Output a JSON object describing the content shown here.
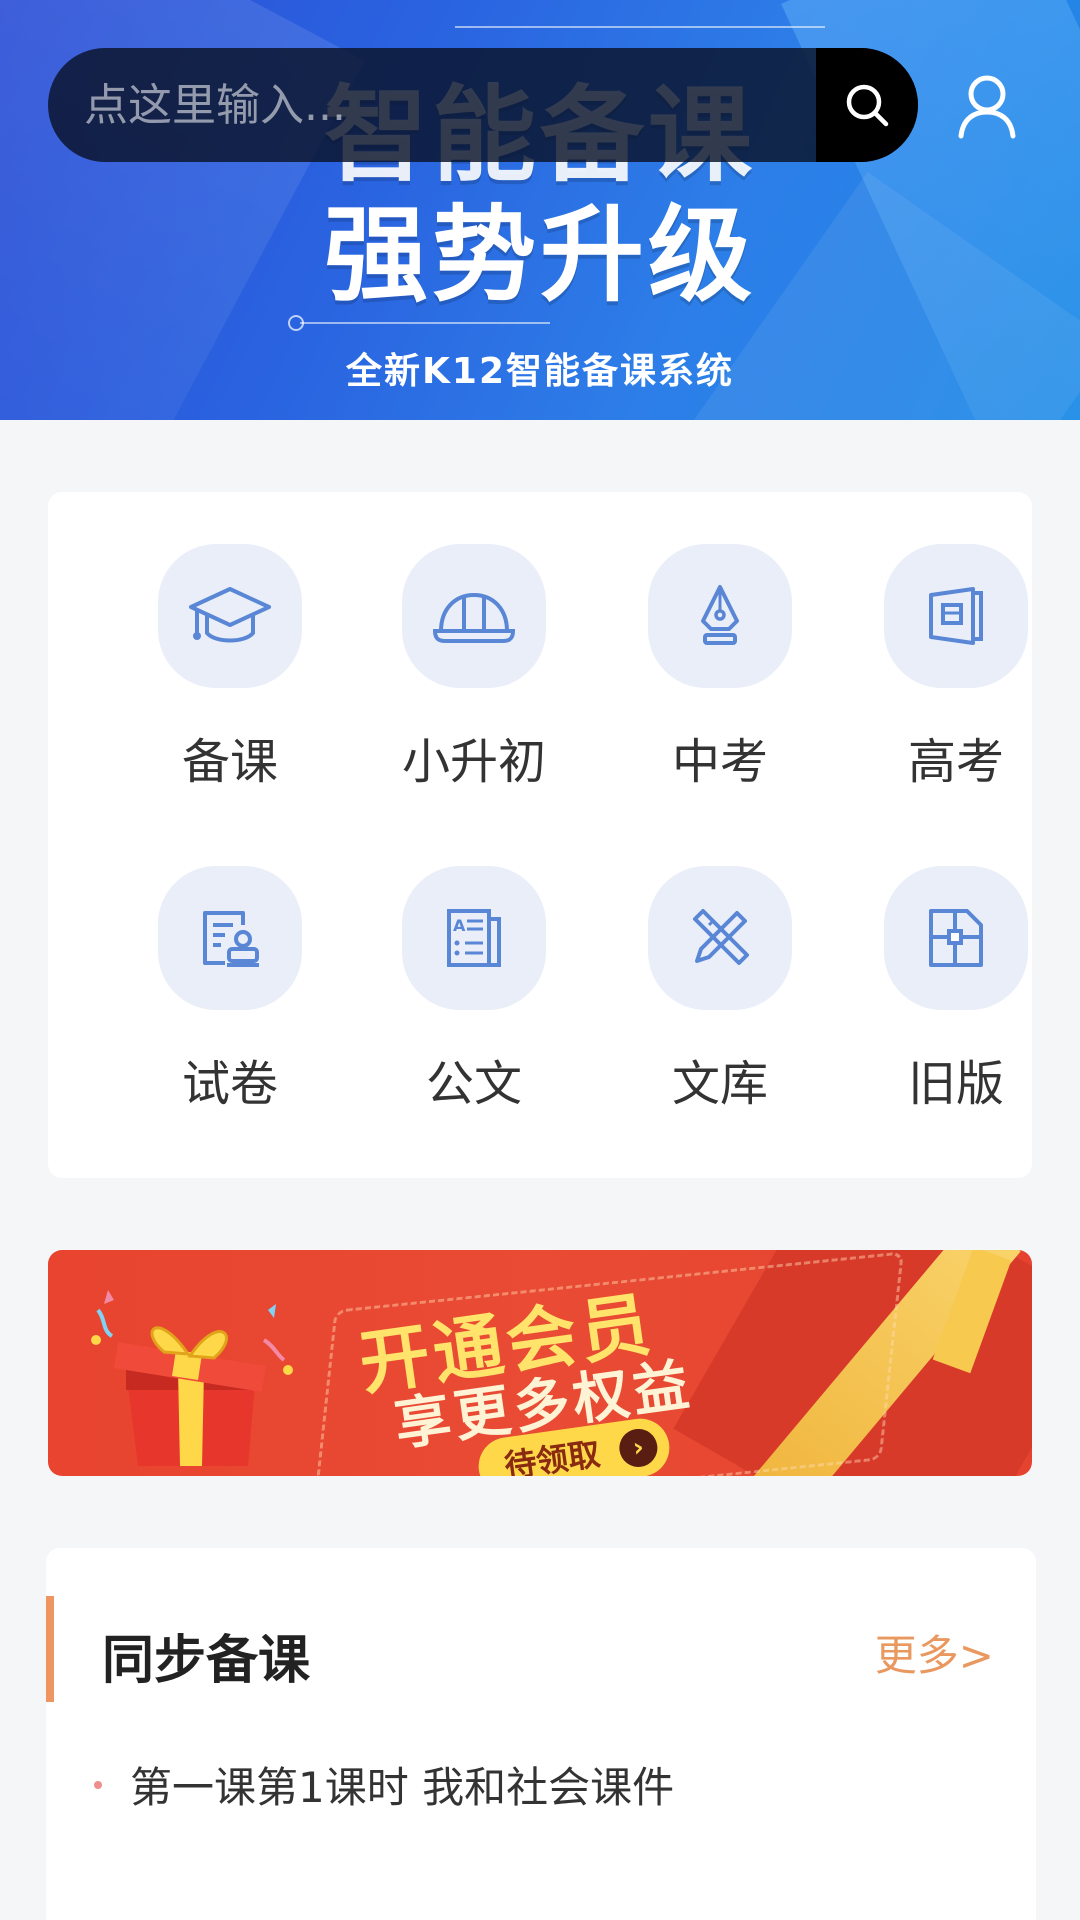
{
  "hero": {
    "headline_1": "智能备课",
    "headline_2": "强势升级",
    "subtitle": "全新K12智能备课系统"
  },
  "search": {
    "placeholder": "点这里输入..."
  },
  "grid": {
    "items": [
      {
        "label": "备课",
        "icon": "graduation-cap-icon"
      },
      {
        "label": "小升初",
        "icon": "helmet-icon"
      },
      {
        "label": "中考",
        "icon": "pen-nib-icon"
      },
      {
        "label": "高考",
        "icon": "book-icon"
      },
      {
        "label": "试卷",
        "icon": "exam-paper-icon"
      },
      {
        "label": "公文",
        "icon": "document-icon"
      },
      {
        "label": "文库",
        "icon": "ruler-pencil-icon"
      },
      {
        "label": "旧版",
        "icon": "file-layout-icon"
      }
    ],
    "icon_color": "#5a86d6",
    "icon_bg": "#e9eef8"
  },
  "promo": {
    "title": "开通会员",
    "subtitle": "享更多权益",
    "cta": "待领取"
  },
  "sync": {
    "title": "同步备课",
    "more": "更多>",
    "items": [
      "第一课第1课时 我和社会课件"
    ],
    "accent_color": "#ef9561"
  }
}
